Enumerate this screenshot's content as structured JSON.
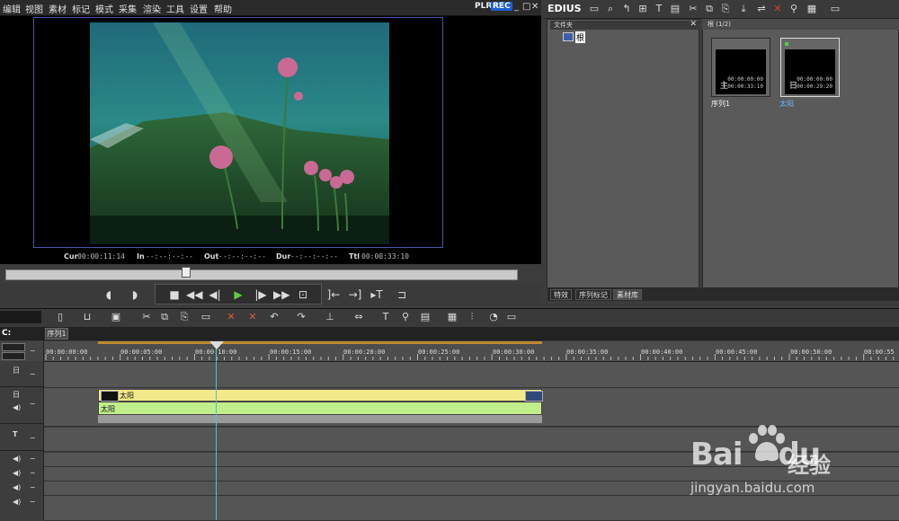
{
  "menu": [
    "编辑",
    "视图",
    "素材",
    "标记",
    "模式",
    "采集",
    "渲染",
    "工具",
    "设置",
    "帮助"
  ],
  "player": {
    "plr_label": "PLR",
    "rec_label": "REC",
    "timecodes": {
      "cur_label": "Cur",
      "cur_value": "00:00:11:14",
      "in_label": "In",
      "in_value": "--:--:--:--",
      "out_label": "Out",
      "out_value": "--:--:--:--",
      "dur_label": "Dur",
      "dur_value": "--:--:--:--",
      "ttl_label": "Ttl",
      "ttl_value": "00:00:33:10"
    },
    "scrub_position": 0.35
  },
  "right": {
    "logo": "EDIUS",
    "folder_header": "文件夹",
    "folder_root": "根",
    "bin_header": "根 (1/2)",
    "clips": [
      {
        "name": "序列1",
        "glyph": "主",
        "tc1": "00:00:00:00",
        "tc2": "00:00:33:10"
      },
      {
        "name": "太阳",
        "glyph": "日",
        "tc1": "00:00:00:00",
        "tc2": "00:00:29:20"
      }
    ],
    "tabs": [
      "特效",
      "序列标记",
      "素材库"
    ]
  },
  "timeline": {
    "tc_label": "C:",
    "sequence_tab": "序列1",
    "ruler_ticks": [
      "00:00:00:00",
      "00:00:05:00",
      "00:00:10:00",
      "00:00:15:00",
      "00:00:20:00",
      "00:00:25:00",
      "00:00:30:00",
      "00:00:35:00",
      "00:00:40:00",
      "00:00:45:00",
      "00:00:50:00",
      "00:00:55"
    ],
    "video_clip_label": "太阳",
    "audio_clip_label": "太阳",
    "track_glyphs": {
      "v1": "日",
      "t1": "T"
    }
  },
  "watermark": {
    "logo": "Bai",
    "logo2": "du",
    "cn": "经验",
    "url": "jingyan.baidu.com"
  },
  "colors": {
    "rec_bg": "#1d5fd0",
    "play_green": "#5ccf3f",
    "video_clip": "#f2e98a",
    "audio_clip": "#bfee8a",
    "cursor": "#49c6c0",
    "inout": "#c08a30"
  }
}
